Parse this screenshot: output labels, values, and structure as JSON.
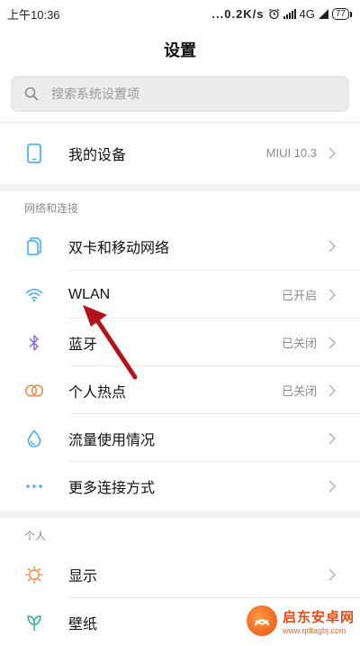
{
  "status_bar": {
    "time": "上午10:36",
    "network_speed": "...0.2K/s",
    "network_type": "4G",
    "battery": "77",
    "alarm_icon": "alarm-icon",
    "signal_icon": "signal-icon"
  },
  "page_title": "设置",
  "search": {
    "placeholder": "搜索系统设置项",
    "value": "",
    "icon": "search-icon"
  },
  "device": {
    "label": "我的设备",
    "value": "MIUI 10.3",
    "icon": "phone-icon"
  },
  "sections": {
    "network": {
      "label": "网络和连接",
      "items": [
        {
          "label": "双卡和移动网络",
          "value": "",
          "icon": "sim-card-icon"
        },
        {
          "label": "WLAN",
          "value": "已开启",
          "icon": "wifi-icon"
        },
        {
          "label": "蓝牙",
          "value": "已关闭",
          "icon": "bluetooth-icon"
        },
        {
          "label": "个人热点",
          "value": "已关闭",
          "icon": "hotspot-icon"
        },
        {
          "label": "流量使用情况",
          "value": "",
          "icon": "data-usage-icon"
        },
        {
          "label": "更多连接方式",
          "value": "",
          "icon": "more-connections-icon"
        }
      ]
    },
    "personal": {
      "label": "个人",
      "items": [
        {
          "label": "显示",
          "value": "",
          "icon": "display-icon"
        },
        {
          "label": "壁纸",
          "value": "",
          "icon": "wallpaper-icon"
        }
      ]
    }
  },
  "watermark": {
    "title": "启东安卓网",
    "url": "www.qdtagbj.com"
  },
  "colors": {
    "accent": "#3aa9ff",
    "orange": "#f08a4b",
    "annotation_arrow": "#b3141c"
  }
}
